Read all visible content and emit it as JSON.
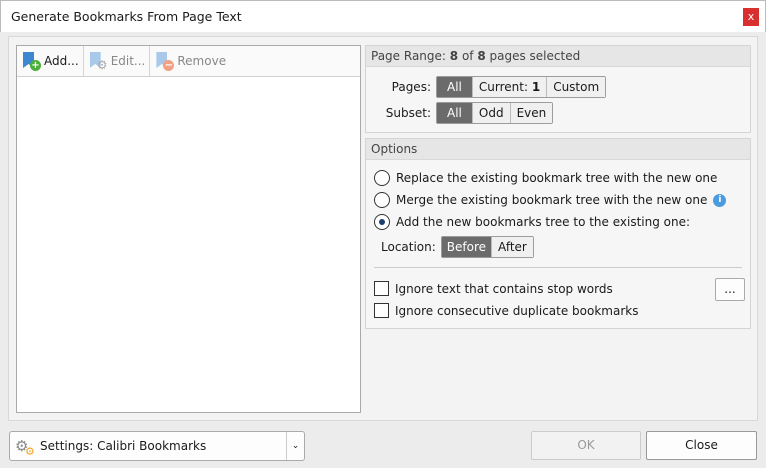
{
  "window": {
    "title": "Generate Bookmarks From Page Text",
    "close": "x"
  },
  "toolbar": {
    "add": "Add...",
    "edit": "Edit...",
    "remove": "Remove"
  },
  "page_range": {
    "prefix": "Page Range: ",
    "selected": "8",
    "of": " of ",
    "total": "8",
    "suffix": " pages selected",
    "pages_label": "Pages:",
    "pages_options": [
      "All",
      "Current: ",
      "Custom"
    ],
    "current_page": "1",
    "subset_label": "Subset:",
    "subset_options": [
      "All",
      "Odd",
      "Even"
    ]
  },
  "options": {
    "header": "Options",
    "radios": [
      "Replace the existing bookmark tree with the new one",
      "Merge the existing bookmark tree with the new one",
      "Add the new bookmarks tree to the existing one:"
    ],
    "location_label": "Location:",
    "location_options": [
      "Before",
      "After"
    ],
    "stop_words": "Ignore text that contains stop words",
    "stop_words_button": "...",
    "duplicates": "Ignore consecutive duplicate bookmarks"
  },
  "footer": {
    "settings_label": "Settings:  Calibri Bookmarks",
    "ok": "OK",
    "close": "Close"
  }
}
